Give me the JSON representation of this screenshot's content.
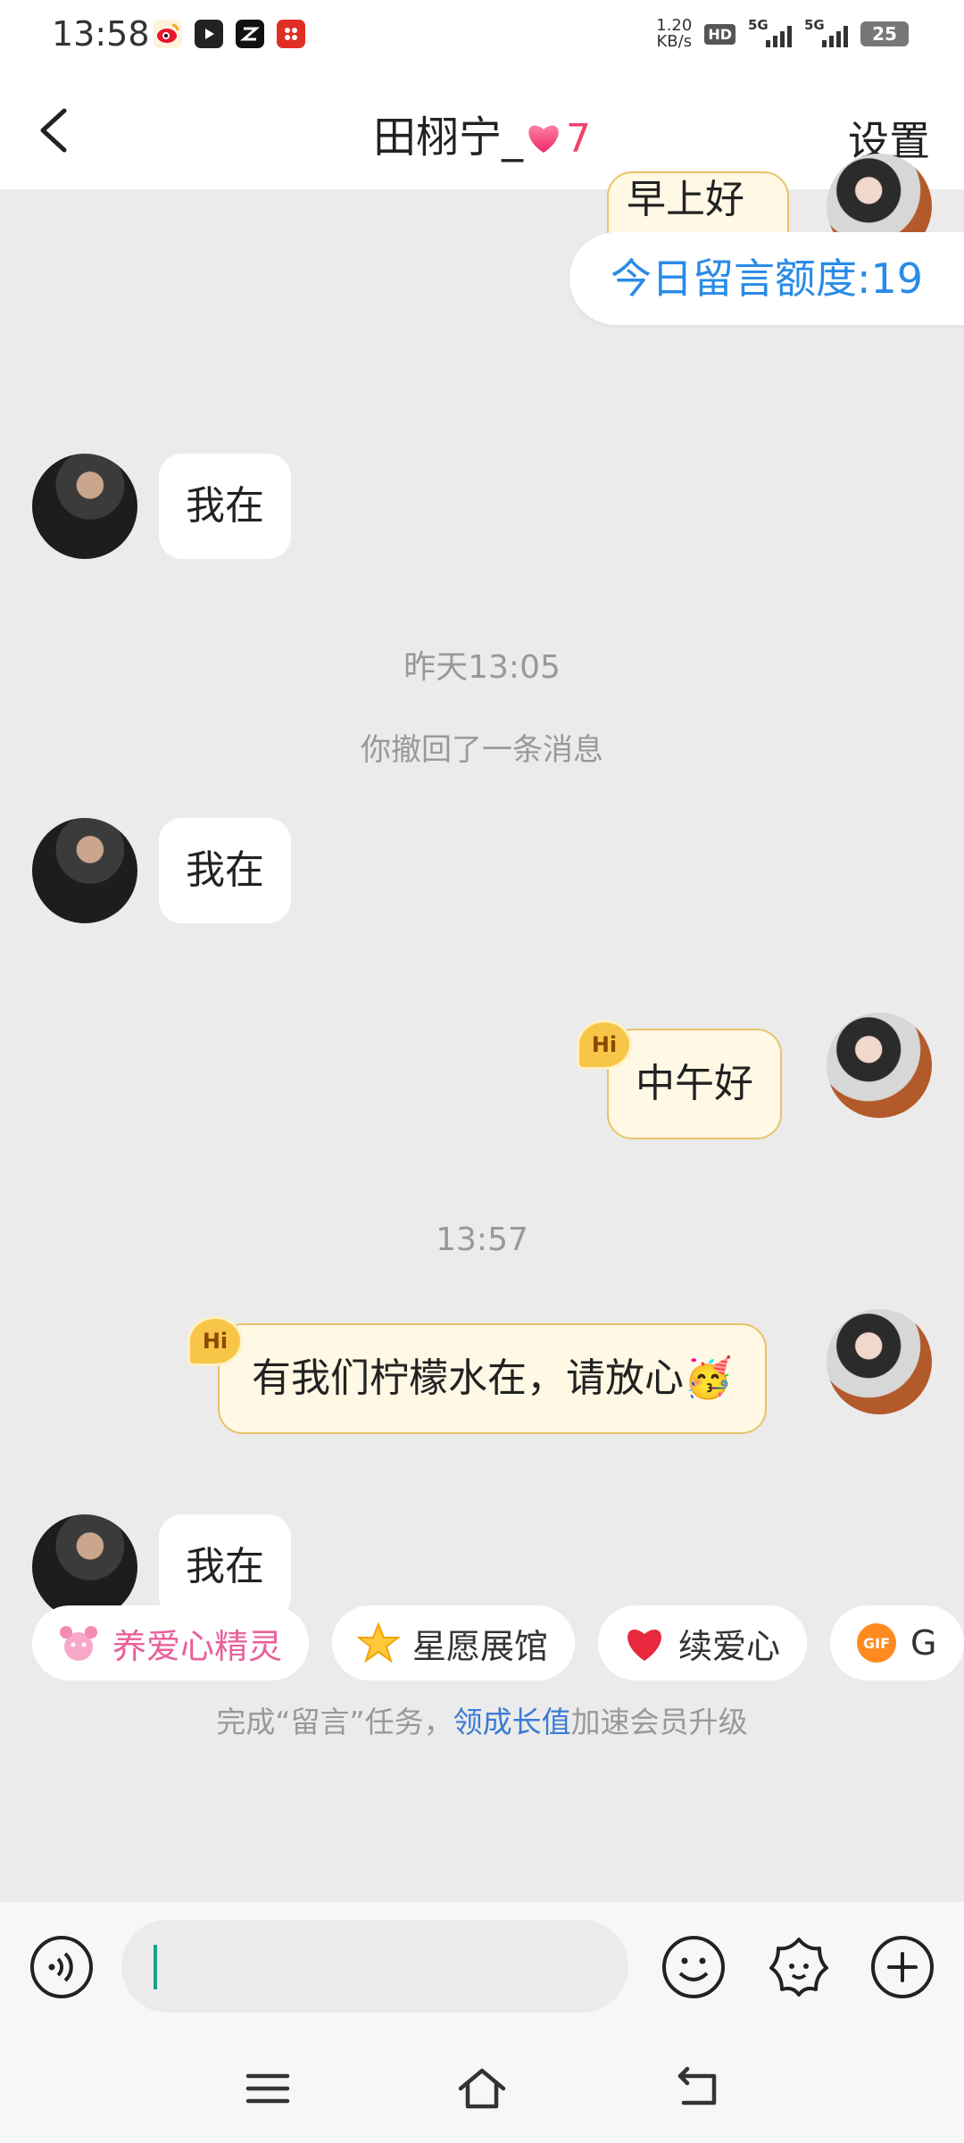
{
  "status_bar": {
    "time": "13:58",
    "net_speed_value": "1.20",
    "net_speed_unit": "KB/s",
    "hd_label": "HD",
    "signal_1_label": "5G",
    "signal_2_label": "5G",
    "battery": "25"
  },
  "header": {
    "title_name": "田栩宁_",
    "intimacy_level": "7",
    "settings_label": "设置"
  },
  "chat": {
    "quota_text": "今日留言额度:19",
    "partial_top_message": "早上好",
    "messages": [
      {
        "side": "left",
        "text": "我在"
      },
      {
        "side": "left",
        "text": "我在"
      },
      {
        "side": "right",
        "text": "中午好",
        "badge": "Hi"
      },
      {
        "side": "right",
        "text": "有我们柠檬水在，请放心🥳",
        "badge": "Hi"
      },
      {
        "side": "left",
        "text": "我在"
      }
    ],
    "timestamp_1": "昨天13:05",
    "recall_notice": "你撤回了一条消息",
    "timestamp_2": "13:57",
    "tip_prefix": "完成“留言”任务，",
    "tip_link": "领成长值",
    "tip_suffix": "加速会员升级"
  },
  "quick_actions": [
    {
      "label": "养爱心精灵",
      "icon": "pink-sprite-icon"
    },
    {
      "label": "星愿展馆",
      "icon": "star-icon"
    },
    {
      "label": "续爱心",
      "icon": "heart-icon"
    },
    {
      "label": "G",
      "icon": "gif-icon"
    }
  ],
  "input_bar": {
    "placeholder": ""
  },
  "colors": {
    "accent_blue": "#2a8be8",
    "intimacy_pink": "#f0416c",
    "bubble_yellow_bg": "#fff8e4",
    "bubble_yellow_border": "#e8c36a",
    "background": "#ebebeb"
  }
}
